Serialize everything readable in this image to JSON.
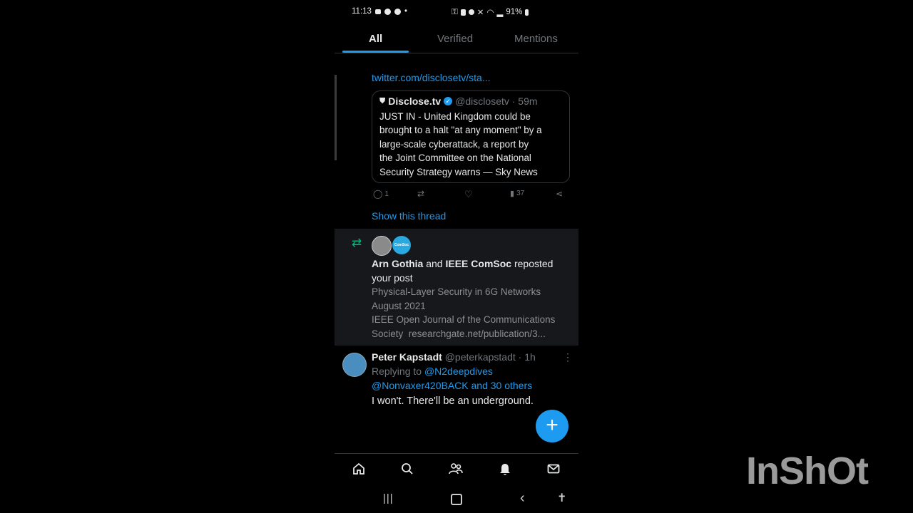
{
  "status_bar": {
    "time": "11:13",
    "battery": "91%"
  },
  "tabs": [
    {
      "label": "All"
    },
    {
      "label": "Verified"
    },
    {
      "label": "Mentions"
    }
  ],
  "thread_item": {
    "link": "twitter.com/disclosetv/sta...",
    "quote": {
      "name": "Disclose.tv",
      "handle_time": "@disclosetv · 59m",
      "lines": [
        "JUST IN - United Kingdom could be",
        "brought to a halt \"at any moment\" by a",
        "large-scale cyberattack, a report by",
        "the Joint Committee on the National",
        "Security Strategy warns — Sky News"
      ]
    },
    "actions": {
      "replies": "1",
      "views": "37"
    },
    "show_thread": "Show this thread"
  },
  "repost_notification": {
    "user1": "Arn Gothia",
    "conj": "and",
    "user2": "IEEE ComSoc",
    "verb": "reposted",
    "line2": "your post",
    "post_lines": [
      "Physical-Layer Security in 6G Networks",
      "August 2021",
      "IEEE Open Journal of the Communications",
      "Society  researchgate.net/publication/3..."
    ],
    "avatar2_text": "ComSoc"
  },
  "tweet": {
    "name": "Peter Kapstadt",
    "handle_time": "@peterkapstadt · 1h",
    "replying_prefix": "Replying to",
    "replying_user": "@N2deepdives",
    "replying_rest": "@Nonvaxer420BACK and 30 others",
    "text": "I won't. There'll be an underground."
  },
  "watermark": "InShOt",
  "colors": {
    "accent": "#1d9bf0",
    "repost_green": "#00ba7c",
    "card_bg": "#16181c"
  }
}
